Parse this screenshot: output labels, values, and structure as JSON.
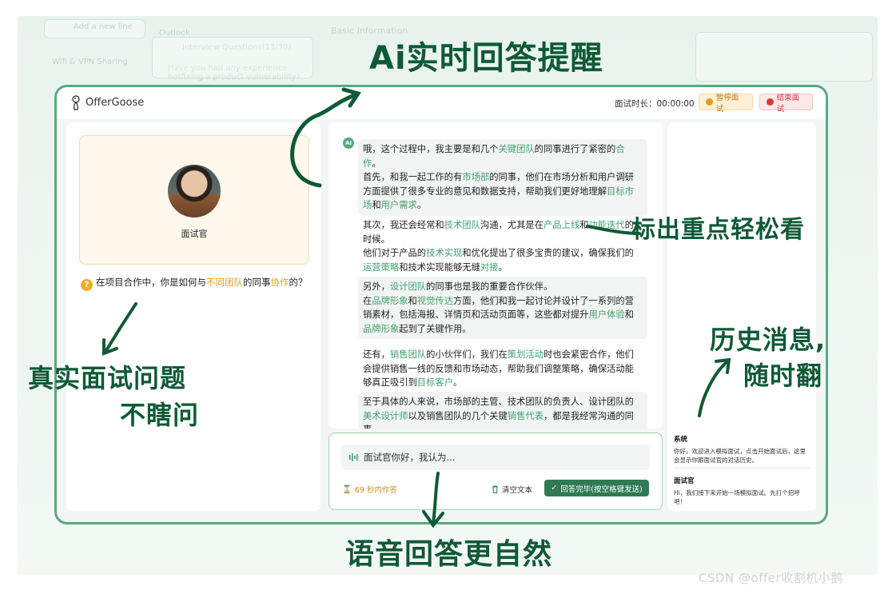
{
  "header": {
    "logo_text": "OfferGoose",
    "timer_label": "面试时长：",
    "timer_value": "00:00:00",
    "pause_label": "暂停面试",
    "end_label": "结束面试"
  },
  "left": {
    "interviewer_label": "面试官",
    "question_parts": [
      "在项目合作中，你是如何与",
      "不同团队",
      "的同事",
      "协作",
      "的？"
    ]
  },
  "conversation": [
    [
      "哦，这个过程中，我主要是和几个",
      {
        "hl": "关键团队"
      },
      "的同事进行了紧密的",
      {
        "hl": "合作"
      },
      "。",
      {
        "br": true
      },
      "首先，和我一起工作的有",
      {
        "hl": "市场部"
      },
      "的同事，他们在市场分析和用户调研方面提供了很多专业的意见和数据支持，帮助我们更好地理解",
      {
        "hl": "目标市场"
      },
      "和",
      {
        "hl": "用户需求"
      },
      "。"
    ],
    [
      "其次，我还会经常和",
      {
        "hl": "技术团队"
      },
      "沟通，尤其是在",
      {
        "hl": "产品上线"
      },
      "和",
      {
        "hl": "功能迭代"
      },
      "的时候。",
      {
        "br": true
      },
      "他们对于产品的",
      {
        "hl": "技术实现"
      },
      "和优化提出了很多宝贵的建议，确保我们的",
      {
        "hl": "运营策略"
      },
      "和技术实现能够无缝",
      {
        "hl": "对接"
      },
      "。"
    ],
    [
      "另外，",
      {
        "hl": "设计团队"
      },
      "的同事也是我的重要合作伙伴。",
      {
        "br": true
      },
      "在",
      {
        "hl": "品牌形象"
      },
      "和",
      {
        "hl": "视觉传达"
      },
      "方面，他们和我一起讨论并设计了一系列的营销素材，包括海报、详情页和活动页面等，这些都对提升",
      {
        "hl": "用户体验"
      },
      "和",
      {
        "hl": "品牌形象"
      },
      "起到了关键作用。"
    ],
    [
      "还有，",
      {
        "hl": "销售团队"
      },
      "的小伙伴们，我们在",
      {
        "hl": "策划活动"
      },
      "时也会紧密合作，他们会提供销售一线的反馈和市场动态，帮助我们调整策略，确保活动能够真正吸引到",
      {
        "hl": "目标客户"
      },
      "。"
    ],
    [
      "至于具体的人来说，市场部的主管、技术团队的负责人、设计团队的",
      {
        "hl": "美术设计师"
      },
      "以及销售团队的几个关键",
      {
        "hl": "销售代表"
      },
      "，都是我经常沟通的同事。"
    ]
  ],
  "input": {
    "text": "面试官你好，我认为...",
    "countdown": "69 秒内作答",
    "clear_label": "清空文本",
    "submit_label": "回答完毕(按空格键发送)"
  },
  "history": [
    {
      "sender": "系统",
      "text": "你好，欢迎进入模拟面试，点击开始面试后，这里会显示你跟面试官的对话历史。"
    },
    {
      "sender": "面试官",
      "text": "Hi，我们接下来开始一场模拟面试。先打个招呼吧！"
    }
  ],
  "background_faded": {
    "tab1": "Add a new line",
    "tab2": "Outlook",
    "tab3": "Interview Questions(13/30)",
    "tab4": "Basic Information",
    "line1": "Wifi & VPN Sharing",
    "line2": "Have you had any experience hotfixing a product vulnerability?"
  },
  "annotations": {
    "top": "Ai实时回答提醒",
    "right_mid": "标出重点轻松看",
    "left": "真实面试问题",
    "left2": "不瞎问",
    "right": "历史消息,",
    "right2": "随时翻",
    "bottom": "语音回答更自然"
  },
  "watermark": "CSDN @offer收割机小鹅",
  "colors": {
    "accent": "#5aa883",
    "highlight": "#3fa171",
    "warning": "#e49b1f",
    "danger": "#d43a3a",
    "annotation": "#0f5a36"
  }
}
